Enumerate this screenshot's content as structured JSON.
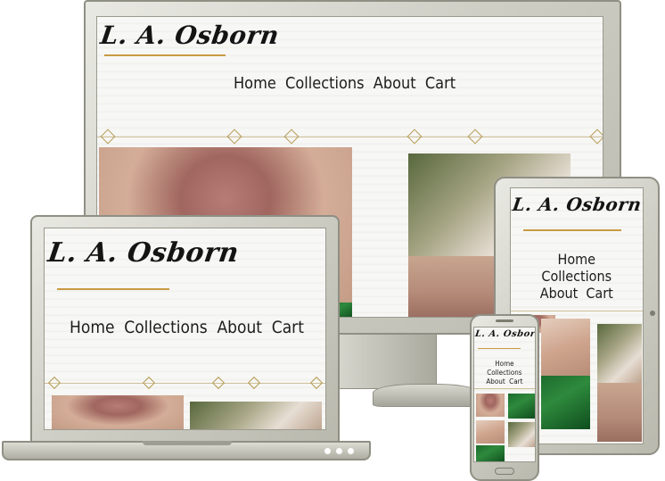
{
  "site": {
    "logo_text": "L. A. Osborn",
    "nav": [
      "Home",
      "Collections",
      "About",
      "Cart"
    ]
  },
  "colors": {
    "logo_underline": "#c99a43",
    "frame": "#cfcfc6",
    "leaf_green": "#1d6b2e"
  },
  "devices": [
    "desktop-monitor",
    "laptop",
    "tablet",
    "phone"
  ]
}
